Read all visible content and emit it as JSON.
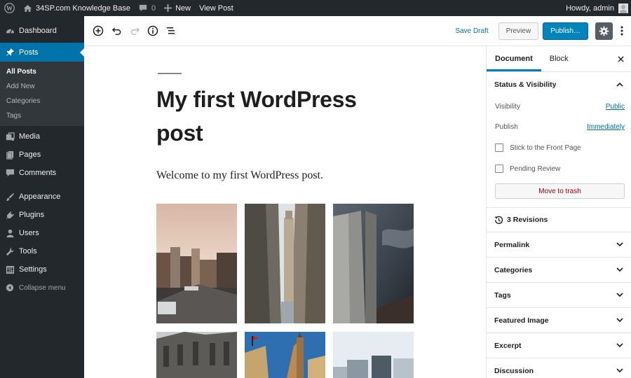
{
  "adminbar": {
    "site_name": "34SP.com Knowledge Base",
    "comments_count": "0",
    "new_label": "New",
    "view_post_label": "View Post",
    "howdy": "Howdy, admin"
  },
  "menu": {
    "dashboard": "Dashboard",
    "posts": "Posts",
    "posts_sub": [
      "All Posts",
      "Add New",
      "Categories",
      "Tags"
    ],
    "media": "Media",
    "pages": "Pages",
    "comments": "Comments",
    "appearance": "Appearance",
    "plugins": "Plugins",
    "users": "Users",
    "tools": "Tools",
    "settings": "Settings",
    "collapse": "Collapse menu"
  },
  "header": {
    "save_draft": "Save Draft",
    "preview": "Preview",
    "publish": "Publish…"
  },
  "post": {
    "title": "My first WordPress post",
    "paragraph": "Welcome to my first WordPress post."
  },
  "sidebar": {
    "tabs": [
      "Document",
      "Block"
    ],
    "status_visibility": "Status & Visibility",
    "visibility_label": "Visibility",
    "visibility_value": "Public",
    "publish_label": "Publish",
    "publish_value": "Immediately",
    "stick_front": "Stick to the Front Page",
    "pending_review": "Pending Review",
    "move_trash": "Move to trash",
    "revisions": "3 Revisions",
    "panels": [
      "Permalink",
      "Categories",
      "Tags",
      "Featured Image",
      "Excerpt",
      "Discussion"
    ]
  },
  "colors": {
    "admin_bg": "#23282d",
    "menu_current": "#0073aa",
    "publish_blue": "#0085ba",
    "link_blue": "#0071a1",
    "trash_red": "#aa0000"
  }
}
